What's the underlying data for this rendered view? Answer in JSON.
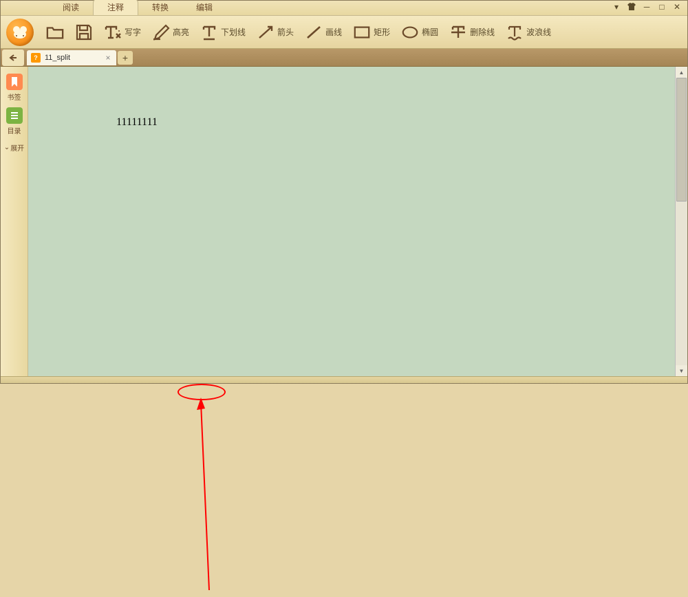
{
  "menu": {
    "tabs": [
      "阅读",
      "注释",
      "转换",
      "编辑"
    ],
    "active_index": 1
  },
  "toolbar": {
    "items": [
      {
        "name": "open",
        "label": ""
      },
      {
        "name": "save",
        "label": ""
      },
      {
        "name": "write",
        "label": "写字"
      },
      {
        "name": "highlight",
        "label": "高亮"
      },
      {
        "name": "underline",
        "label": "下划线"
      },
      {
        "name": "arrow",
        "label": "箭头"
      },
      {
        "name": "line",
        "label": "画线"
      },
      {
        "name": "rect",
        "label": "矩形"
      },
      {
        "name": "oval",
        "label": "椭圆"
      },
      {
        "name": "strikeout",
        "label": "删除线"
      },
      {
        "name": "wavy",
        "label": "波浪线"
      }
    ]
  },
  "tabs": {
    "open": [
      {
        "title": "11_split"
      }
    ],
    "add_label": "+"
  },
  "sidebar": {
    "items": [
      {
        "name": "bookmark",
        "label": "书签",
        "color": "#ff8a50"
      },
      {
        "name": "toc",
        "label": "目录",
        "color": "#7cb342"
      }
    ],
    "expand_label": "展开"
  },
  "document": {
    "content": "11111111"
  }
}
